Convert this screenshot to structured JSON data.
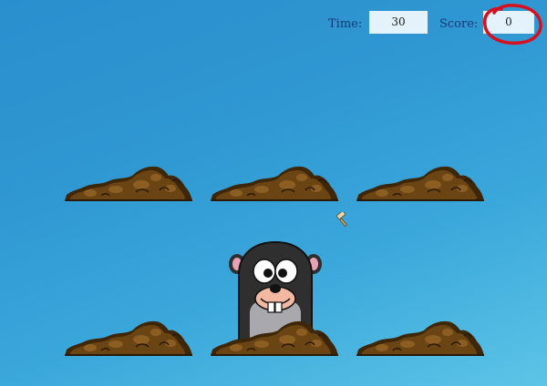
{
  "hud": {
    "time_label": "Time:",
    "time_value": "30",
    "score_label": "Score:",
    "score_value": "0"
  },
  "colors": {
    "background_top": "#2a8fce",
    "background_bottom": "#5cc4e6",
    "hud_label": "#123a7a",
    "hud_box": "#e3f2fb",
    "annotation_circle": "#d8101e",
    "dirt_dark": "#3d2708",
    "dirt_mid": "#6b4414",
    "dirt_light": "#8d5e22",
    "mole_body": "#2f2f2f",
    "mole_belly": "#a9a9ad"
  },
  "game": {
    "holes": 6,
    "active_hole": 5,
    "cursor_icon": "hammer-icon"
  }
}
